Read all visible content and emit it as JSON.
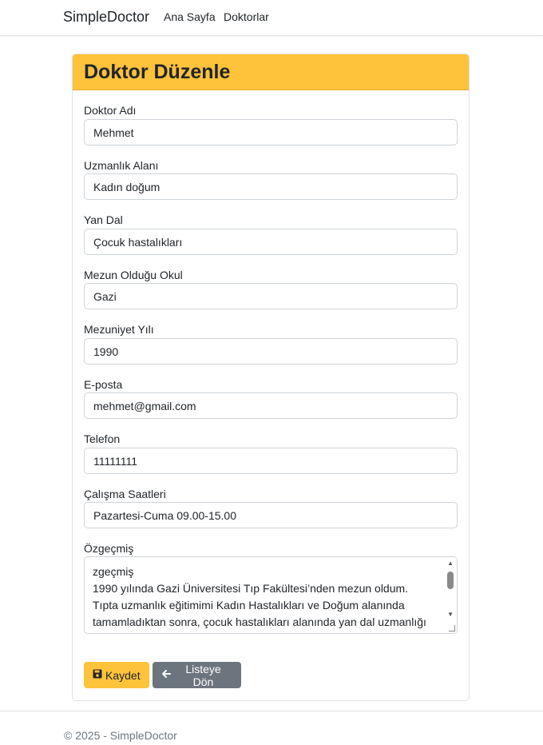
{
  "navbar": {
    "brand": "SimpleDoctor",
    "links": [
      "Ana Sayfa",
      "Doktorlar"
    ]
  },
  "card": {
    "title": "Doktor Düzenle"
  },
  "fields": [
    {
      "label": "Doktor Adı",
      "value": "Mehmet"
    },
    {
      "label": "Uzmanlık Alanı",
      "value": "Kadın doğum"
    },
    {
      "label": "Yan Dal",
      "value": "Çocuk hastalıkları"
    },
    {
      "label": "Mezun Olduğu Okul",
      "value": "Gazi"
    },
    {
      "label": "Mezuniyet Yılı",
      "value": "1990"
    },
    {
      "label": "E-posta",
      "value": "mehmet@gmail.com"
    },
    {
      "label": "Telefon",
      "value": "11111111"
    },
    {
      "label": "Çalışma Saatleri",
      "value": "Pazartesi-Cuma 09.00-15.00"
    }
  ],
  "bio": {
    "label": "Özgeçmiş",
    "text": "zgeçmiş\n1990 yılında Gazi Üniversitesi Tıp Fakültesi’nden mezun oldum. Tıpta uzmanlık eğitimimi Kadın Hastalıkları ve Doğum alanında tamamladıktan sonra, çocuk hastalıkları alanında yan dal uzmanlığı"
  },
  "actions": {
    "save_label": "Kaydet",
    "back_label": "Listeye Dön"
  },
  "footer": {
    "text": "© 2025 - SimpleDoctor"
  },
  "icons": {
    "save": "floppy-disk-icon",
    "back": "arrow-left-icon"
  },
  "colors": {
    "accent": "#ffc23b",
    "secondary": "#6c757d"
  }
}
